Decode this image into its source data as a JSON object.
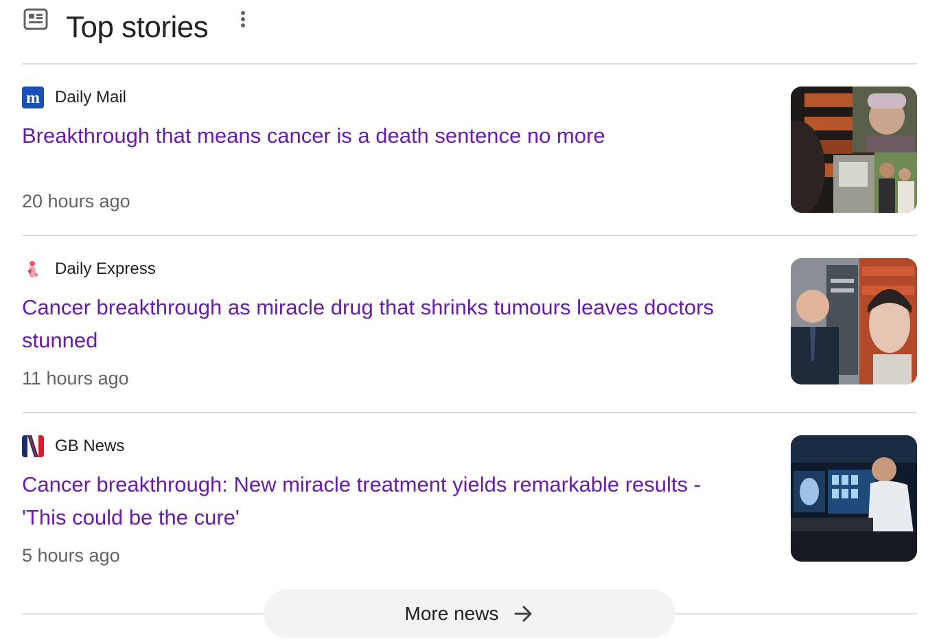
{
  "header": {
    "title": "Top stories",
    "icon": "newspaper-icon",
    "menu_icon": "more-vert-icon"
  },
  "stories": [
    {
      "source": "Daily Mail",
      "favicon": "daily-mail-logo",
      "headline": "Breakthrough that means cancer is a death sentence no more",
      "time": "20 hours ago"
    },
    {
      "source": "Daily Express",
      "favicon": "daily-express-logo",
      "headline": "Cancer breakthrough as miracle drug that shrinks tumours leaves doctors stunned",
      "time": "11 hours ago"
    },
    {
      "source": "GB News",
      "favicon": "gb-news-logo",
      "headline": "Cancer breakthrough: New miracle treatment yields remarkable results - 'This could be the cure'",
      "time": "5 hours ago"
    }
  ],
  "more": {
    "label": "More news",
    "icon": "arrow-right-icon"
  },
  "colors": {
    "headline": "#681da8",
    "text": "#202124",
    "secondary": "#5f6368",
    "divider": "#dadce0",
    "button_bg": "#f1f3f4"
  }
}
